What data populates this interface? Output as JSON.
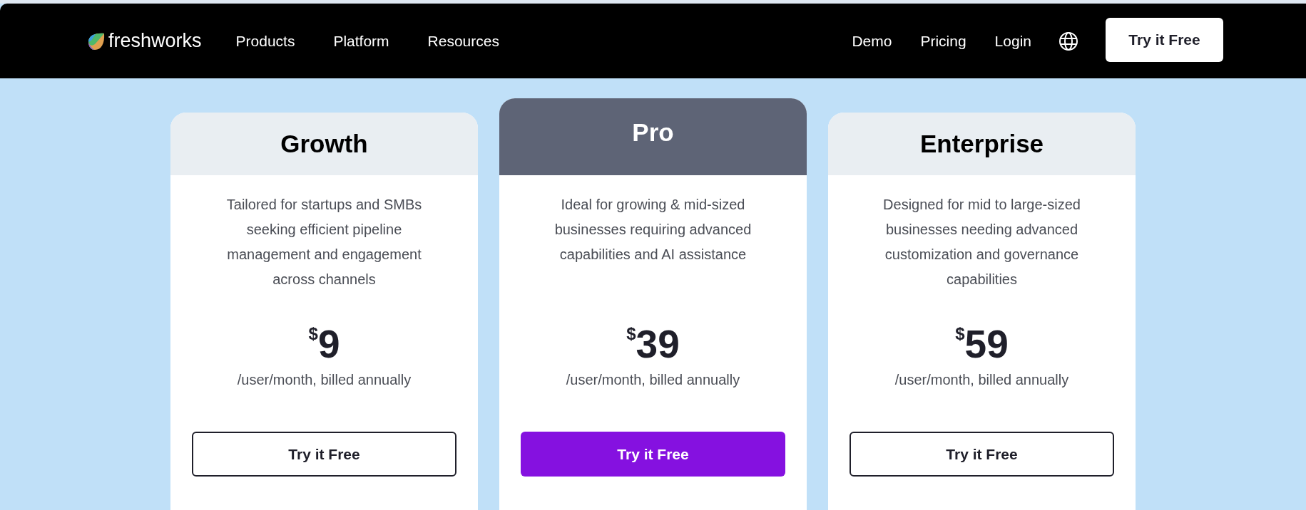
{
  "nav": {
    "brand": "freshworks",
    "links": [
      "Products",
      "Platform",
      "Resources"
    ],
    "right_links": [
      "Demo",
      "Pricing",
      "Login"
    ],
    "cta": "Try it Free"
  },
  "plans": [
    {
      "name": "Growth",
      "featured": false,
      "description": "Tailored for startups and SMBs seeking efficient pipeline management and engagement across channels",
      "currency": "$",
      "amount": "9",
      "period": "/user/month, billed annually",
      "cta": "Try it Free"
    },
    {
      "name": "Pro",
      "featured": true,
      "description": "Ideal for growing & mid-sized businesses requiring advanced capabilities and AI assistance",
      "currency": "$",
      "amount": "39",
      "period": "/user/month, billed annually",
      "cta": "Try it Free"
    },
    {
      "name": "Enterprise",
      "featured": false,
      "description": "Designed for mid to large-sized businesses needing advanced customization and governance capabilities",
      "currency": "$",
      "amount": "59",
      "period": "/user/month, billed annually",
      "cta": "Try it Free"
    }
  ]
}
